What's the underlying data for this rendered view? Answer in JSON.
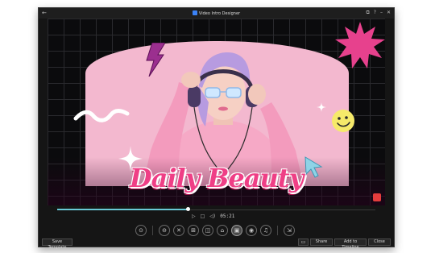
{
  "window": {
    "title": "Video Intro Designer",
    "back_glyph": "←",
    "controls": [
      "⧉",
      "?",
      "–",
      "✕"
    ]
  },
  "stage": {
    "headline": "Daily Beauty"
  },
  "playback": {
    "play_glyph": "▷",
    "stop_glyph": "□",
    "volume_glyph": "◁)",
    "time": "05:21",
    "progress": 0.41
  },
  "toolbar": {
    "tools": [
      {
        "name": "settings-icon",
        "glyph": "⊙"
      },
      {
        "name": "title-icon",
        "glyph": "⊖"
      },
      {
        "name": "cut-icon",
        "glyph": "✕"
      },
      {
        "name": "layout-icon",
        "glyph": "⊞"
      },
      {
        "name": "text-icon",
        "glyph": "◫"
      },
      {
        "name": "crop-icon",
        "glyph": "⌂"
      },
      {
        "name": "image-icon",
        "glyph": "▣"
      },
      {
        "name": "sticker-icon",
        "glyph": "◉"
      },
      {
        "name": "music-icon",
        "glyph": "♫"
      },
      {
        "name": "export-icon",
        "glyph": "⇲"
      }
    ]
  },
  "bottom": {
    "save_template": "Save Template",
    "share": "Share",
    "add_to_timeline": "Add to Timeline",
    "close": "Close"
  },
  "colors": {
    "accent": "#69c9d6",
    "headline_pink": "#ef3f86",
    "panel_pink": "#f3b8cf"
  }
}
